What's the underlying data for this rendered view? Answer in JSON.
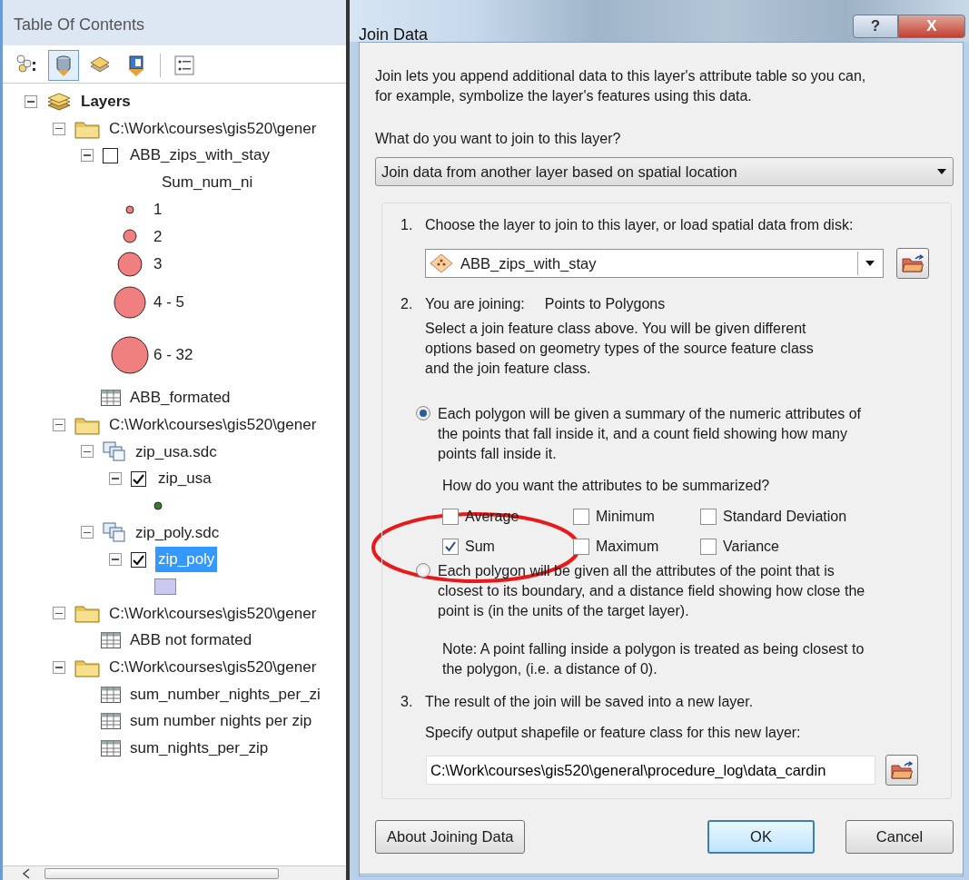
{
  "toc": {
    "title": "Table Of Contents",
    "tools": [
      {
        "kind": "drawing-order",
        "selected": false
      },
      {
        "kind": "source",
        "selected": true
      },
      {
        "kind": "visibility",
        "selected": false
      },
      {
        "kind": "selection",
        "selected": false
      },
      {
        "kind": "options",
        "selected": false
      }
    ],
    "tree": [
      {
        "kind": "frame",
        "label": "Layers",
        "expanded": true,
        "children": [
          {
            "kind": "folder",
            "label": "C:\\Work\\courses\\gis520\\gener",
            "expanded": true,
            "children": [
              {
                "kind": "layer",
                "label": "ABB_zips_with_stay",
                "checked": false,
                "selected": false,
                "expanded": true,
                "children": [
                  {
                    "kind": "heading",
                    "label": "Sum_num_ni"
                  },
                  {
                    "kind": "tiny-point",
                    "color": "#f08080",
                    "label": "1"
                  },
                  {
                    "kind": "small-point",
                    "color": "#f08080",
                    "label": "2"
                  },
                  {
                    "kind": "medium-point",
                    "color": "#f08080",
                    "label": "3"
                  },
                  {
                    "kind": "large-point",
                    "color": "#f08080",
                    "label": "4 - 5"
                  },
                  {
                    "kind": "huge-point",
                    "color": "#f08080",
                    "label": "6 - 32"
                  }
                ]
              },
              {
                "kind": "table",
                "label": "ABB_formated"
              }
            ]
          },
          {
            "kind": "folder",
            "label": "C:\\Work\\courses\\gis520\\gener",
            "expanded": true,
            "children": [
              {
                "kind": "dataset",
                "label": "zip_usa.sdc",
                "expanded": true,
                "children": [
                  {
                    "kind": "layer",
                    "label": "zip_usa",
                    "checked": true,
                    "selected": false,
                    "expanded": true,
                    "children": [
                      {
                        "kind": "tiny-point",
                        "color": "#3a7d2c"
                      }
                    ]
                  }
                ]
              },
              {
                "kind": "dataset",
                "label": "zip_poly.sdc",
                "expanded": true,
                "children": [
                  {
                    "kind": "layer",
                    "label": "zip_poly",
                    "checked": true,
                    "selected": true,
                    "expanded": true,
                    "children": [
                      {
                        "kind": "fill",
                        "color": "#c8c8f0"
                      }
                    ]
                  }
                ]
              }
            ]
          },
          {
            "kind": "folder",
            "label": "C:\\Work\\courses\\gis520\\gener",
            "expanded": true,
            "children": [
              {
                "kind": "table",
                "label": "ABB not formated"
              }
            ]
          },
          {
            "kind": "folder",
            "label": "C:\\Work\\courses\\gis520\\gener",
            "expanded": true,
            "children": [
              {
                "kind": "table",
                "label": "sum_number_nights_per_zi"
              },
              {
                "kind": "table",
                "label": "sum number nights per zip"
              },
              {
                "kind": "table",
                "label": "sum_nights_per_zip"
              }
            ]
          }
        ]
      }
    ]
  },
  "dialog": {
    "title": "Join Data",
    "help_button": "?",
    "close_button": "X",
    "intro": "Join lets you append additional data to this layer's attribute table so you can,\nfor example, symbolize the layer's features using this data.",
    "question": "What do you want to join to this layer?",
    "join_type": {
      "value": "Join data from another layer based on spatial location"
    },
    "step1": {
      "number": "1.",
      "label": "Choose the layer to join to this layer, or load spatial data from disk:",
      "layer": {
        "value": "ABB_zips_with_stay"
      }
    },
    "step2": {
      "number": "2.",
      "label": "You are joining:",
      "value": "Points to Polygons",
      "description": "Select a join feature class above.  You will be given different\noptions based on geometry types of the source feature class\nand the join feature class.",
      "options": [
        {
          "text": "Each polygon will be given a summary of the numeric attributes of\nthe points that fall inside it, and a count field showing how many\npoints fall inside it.",
          "selected": true
        },
        {
          "text": "Each polygon will be given all the attributes of the point that is\nclosest to its boundary, and a distance field showing how close the\npoint is (in the units of the target layer).",
          "selected": false
        }
      ],
      "summary_question": "How do you want the attributes to be summarized?",
      "statistics": [
        {
          "label": "Average",
          "checked": false
        },
        {
          "label": "Minimum",
          "checked": false
        },
        {
          "label": "Standard Deviation",
          "checked": false
        },
        {
          "label": "Sum",
          "checked": true
        },
        {
          "label": "Maximum",
          "checked": false
        },
        {
          "label": "Variance",
          "checked": false
        }
      ],
      "note": "Note: A point falling inside a polygon is treated as being closest to\nthe polygon, (i.e. a distance of 0)."
    },
    "step3": {
      "number": "3.",
      "label": "The result of the join will be saved into a new layer.",
      "prompt": "Specify output shapefile or feature class for this new layer:",
      "output": {
        "value": "C:\\Work\\courses\\gis520\\general\\procedure_log\\data_cardin"
      }
    },
    "buttons": [
      {
        "label": "About Joining Data",
        "kind": "help"
      },
      {
        "label": "OK",
        "kind": "default"
      },
      {
        "label": "Cancel",
        "kind": "cancel"
      }
    ]
  }
}
